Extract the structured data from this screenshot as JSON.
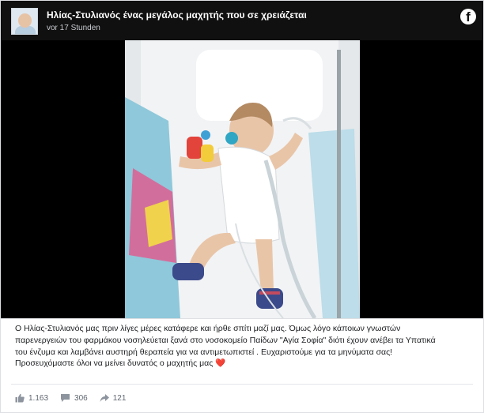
{
  "post": {
    "page_name": "Ηλίας-Στυλιανός ένας μεγάλος μαχητής που σε χρειάζεται",
    "timestamp": "vor 17 Stunden",
    "platform_icon": "facebook-icon",
    "caption_lines": [
      "Ο Ηλίας-Στυλιανός μας πριν λίγες μέρες κατάφερε και ήρθε σπίτι μαζί μας. Όμως λόγο κάποιων γνωστών",
      "παρενεργειών του φαρμάκου νοσηλεύεται ξανά στο νοσοκομείο Παίδων \"Αγία Σοφία\" διότι έχουν ανέβει τα Υπατικά",
      "του ένζυμα και λαμβάνει αυστηρή θεραπεία για να αντιμετωπιστεί . Ευχαριστούμε για τα μηνύματα σας!",
      "Προσευχόμαστε όλοι να μείνει δυνατός ο μαχητής μας"
    ],
    "heart_emoji": "❤️",
    "stats": {
      "likes": "1.163",
      "comments": "306",
      "shares": "121"
    }
  },
  "colors": {
    "header_bg": "#101010",
    "media_bg": "#000000",
    "heart": "#e0245e",
    "stat_text": "#606770"
  }
}
